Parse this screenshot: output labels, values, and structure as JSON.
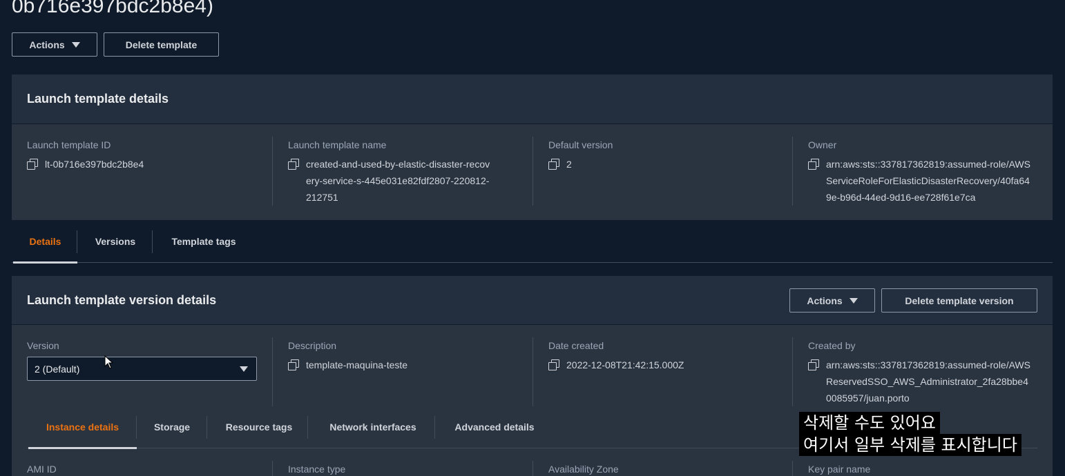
{
  "page": {
    "title_partial": "0b716e397bdc2b8e4)"
  },
  "toolbar": {
    "actions_label": "Actions",
    "delete_label": "Delete template"
  },
  "template_details": {
    "title": "Launch template details",
    "fields": [
      {
        "label": "Launch template ID",
        "value": "lt-0b716e397bdc2b8e4"
      },
      {
        "label": "Launch template name",
        "value": "created-and-used-by-elastic-disaster-recovery-service-s-445e031e82fdf2807-220812-212751"
      },
      {
        "label": "Default version",
        "value": "2"
      },
      {
        "label": "Owner",
        "value": "arn:aws:sts::337817362819:assumed-role/AWSServiceRoleForElasticDisasterRecovery/40fa649e-b96d-44ed-9d16-ee728f61e7ca"
      }
    ]
  },
  "tabs": [
    {
      "label": "Details",
      "active": true
    },
    {
      "label": "Versions",
      "active": false
    },
    {
      "label": "Template tags",
      "active": false
    }
  ],
  "version_details": {
    "title": "Launch template version details",
    "actions_label": "Actions",
    "delete_label": "Delete template version",
    "version_label": "Version",
    "version_selected": "2 (Default)",
    "description_label": "Description",
    "description_value": "template-maquina-teste",
    "date_label": "Date created",
    "date_value": "2022-12-08T21:42:15.000Z",
    "created_by_label": "Created by",
    "created_by_value": "arn:aws:sts::337817362819:assumed-role/AWSReservedSSO_AWS_Administrator_2fa28bbe40085957/juan.porto"
  },
  "subtabs": [
    {
      "label": "Instance details",
      "active": true
    },
    {
      "label": "Storage",
      "active": false
    },
    {
      "label": "Resource tags",
      "active": false
    },
    {
      "label": "Network interfaces",
      "active": false
    },
    {
      "label": "Advanced details",
      "active": false
    }
  ],
  "instance_fields": [
    {
      "label": "AMI ID"
    },
    {
      "label": "Instance type"
    },
    {
      "label": "Availability Zone"
    },
    {
      "label": "Key pair name"
    }
  ],
  "subtitles": {
    "line1": "삭제할 수도 있어요",
    "line2": "여기서 일부 삭제를 표시합니다"
  },
  "colors": {
    "accent": "#ec7211",
    "background": "#0f1b2a",
    "panel": "#232f3e"
  }
}
